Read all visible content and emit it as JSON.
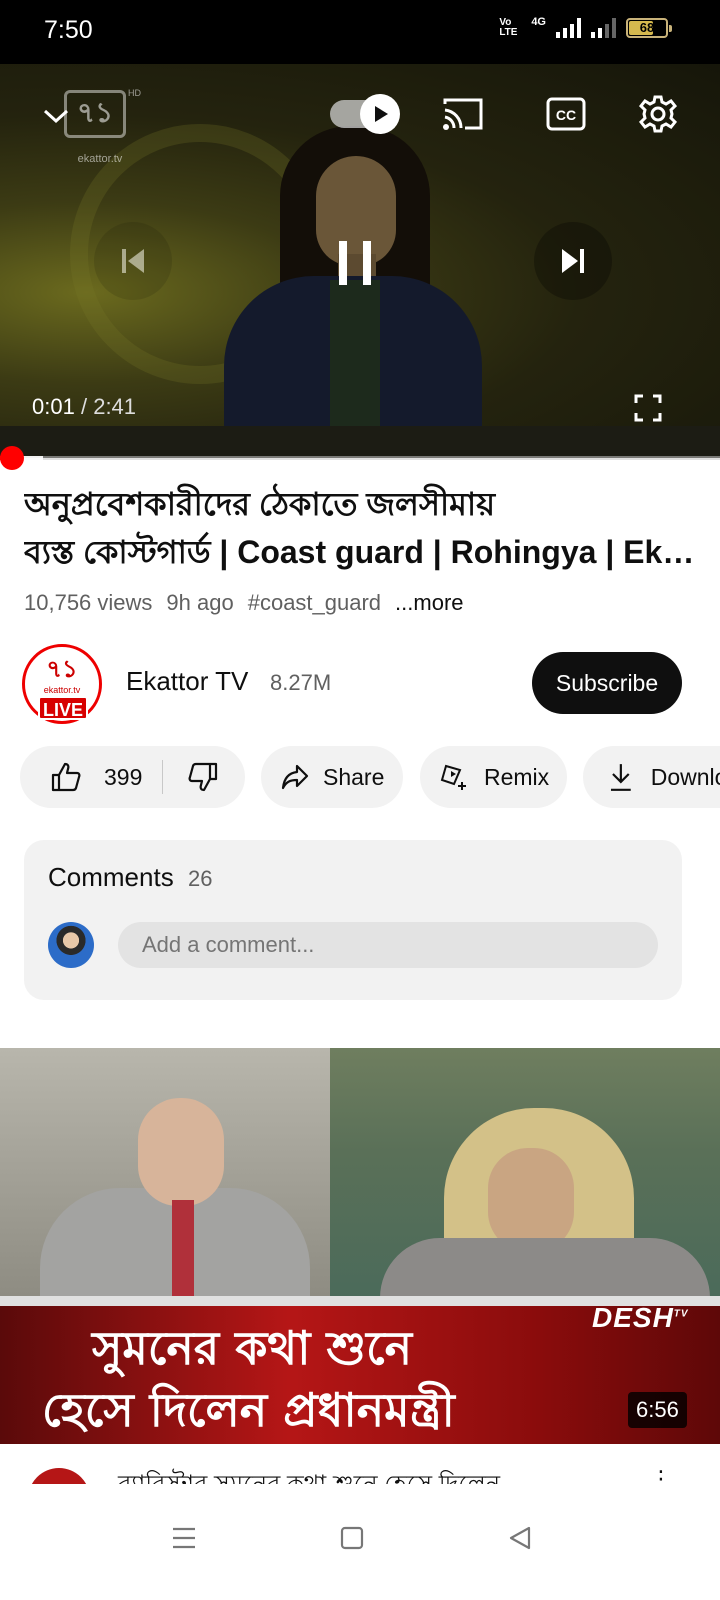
{
  "status_bar": {
    "time": "7:50",
    "volte": "Vo LTE",
    "network": "4G",
    "battery": "68",
    "battery_level": 0.68
  },
  "player": {
    "watermark": "৭১",
    "watermark_sub": "ekattor.tv",
    "watermark_hd": "HD",
    "current_time": "0:01",
    "separator": "/",
    "duration": "2:41",
    "progress_fraction": 0.006,
    "buffer_fraction": 0.06,
    "cc_label": "CC",
    "icons": [
      "chevron-down-icon",
      "autoplay-toggle-icon",
      "cast-icon",
      "cc-icon",
      "settings-icon",
      "previous-icon",
      "pause-icon",
      "next-icon",
      "fullscreen-icon"
    ]
  },
  "video": {
    "title_line1": "অনুপ্রবেশকারীদের ঠেকাতে জলসীমায়",
    "title_line2": "ব্যস্ত কোস্টগার্ড | Coast guard | Rohingya | Ekattor TV",
    "views": "10,756 views",
    "age": "9h ago",
    "hashtag": "#coast_guard",
    "more": "...more"
  },
  "channel": {
    "avatar_logo": "৭১",
    "avatar_sub": "ekattor.tv",
    "live_badge": "LIVE",
    "name": "Ekattor TV",
    "subscribers": "8.27M",
    "subscribe_label": "Subscribe"
  },
  "actions": {
    "like_count": "399",
    "share_label": "Share",
    "remix_label": "Remix",
    "download_label": "Download"
  },
  "comments": {
    "heading": "Comments",
    "count": "26",
    "placeholder": "Add a comment..."
  },
  "next_video": {
    "thumb_line1": "সুমনের কথা শুনে",
    "thumb_line2": "হেসে দিলেন প্রধানমন্ত্রী",
    "channel_logo": "DESH",
    "channel_logo_sup": "TV",
    "duration": "6:56",
    "title": "ব্যারিস্টার সুমনের কথা শুনে হেসে দিলেন",
    "menu": "⋮"
  },
  "colors": {
    "accent_red": "#ff0000",
    "subscribe_bg": "#0f0f0f",
    "chip_bg": "#f2f2f2",
    "text_secondary": "#606060"
  }
}
